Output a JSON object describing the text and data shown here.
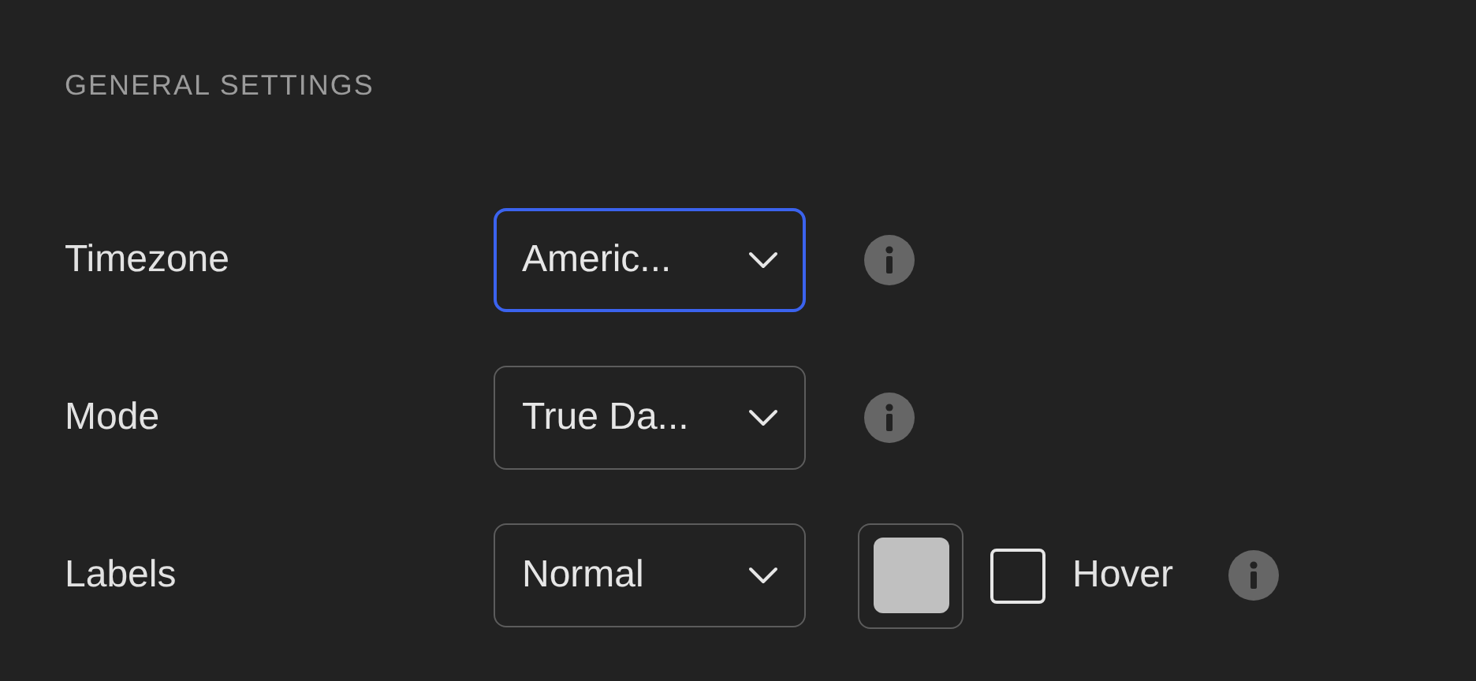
{
  "section_title": "GENERAL SETTINGS",
  "rows": [
    {
      "label": "Timezone",
      "select": {
        "value": "Americ...",
        "focused": true
      }
    },
    {
      "label": "Mode",
      "select": {
        "value": "True Da...",
        "focused": false
      }
    },
    {
      "label": "Labels",
      "select": {
        "value": "Normal",
        "focused": false
      },
      "color": "#c0c0c0",
      "checkbox": {
        "label": "Hover",
        "checked": false
      }
    }
  ]
}
